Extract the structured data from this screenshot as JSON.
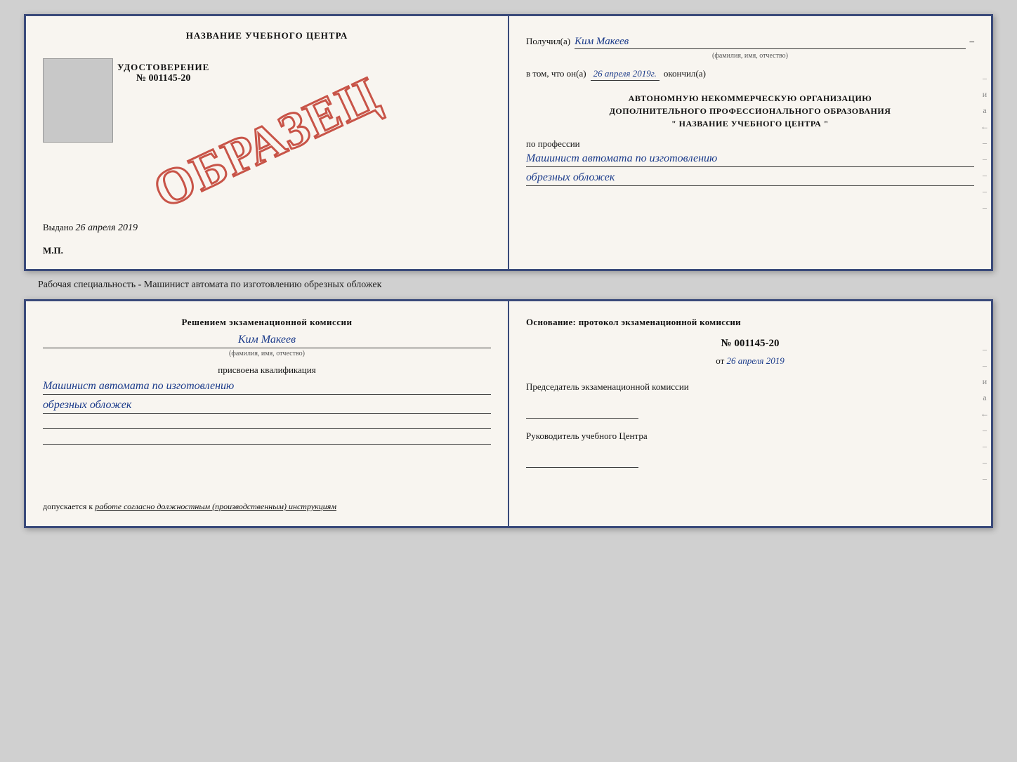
{
  "top_doc": {
    "left": {
      "title": "НАЗВАНИЕ УЧЕБНОГО ЦЕНТРА",
      "obrazec": "ОБРАЗЕЦ",
      "udost_label": "УДОСТОВЕРЕНИЕ",
      "udost_num": "№ 001145-20",
      "vydano_prefix": "Выдано",
      "vydano_date": "26 апреля 2019",
      "mp": "М.П."
    },
    "right": {
      "poluchil_prefix": "Получил(а)",
      "poluchil_name": "Ким Макеев",
      "fio_label": "(фамилия, имя, отчество)",
      "vtom_prefix": "в том, что он(а)",
      "vtom_date": "26 апреля 2019г.",
      "okончil": "окончил(а)",
      "org_line1": "АВТОНОМНУЮ НЕКОММЕРЧЕСКУЮ ОРГАНИЗАЦИЮ",
      "org_line2": "ДОПОЛНИТЕЛЬНОГО ПРОФЕССИОНАЛЬНОГО ОБРАЗОВАНИЯ",
      "org_line3": "\"  НАЗВАНИЕ УЧЕБНОГО ЦЕНТРА  \"",
      "po_professii": "по профессии",
      "profession1": "Машинист автомата по изготовлению",
      "profession2": "обрезных обложек"
    }
  },
  "caption": "Рабочая специальность - Машинист автомата по изготовлению обрезных обложек",
  "bottom_doc": {
    "left": {
      "resheniem": "Решением экзаменационной комиссии",
      "name": "Ким Макеев",
      "fio_label": "(фамилия, имя, отчество)",
      "prisvoena": "присвоена квалификация",
      "profession1": "Машинист автомата по изготовлению",
      "profession2": "обрезных обложек",
      "dopusk_prefix": "допускается к",
      "dopusk_val": "работе согласно должностным (производственным) инструкциям"
    },
    "right": {
      "osnovanie": "Основание: протокол экзаменационной комиссии",
      "protocol_num": "№  001145-20",
      "ot_prefix": "от",
      "ot_date": "26 апреля 2019",
      "predsedatel_label": "Председатель экзаменационной комиссии",
      "rukovoditel_label": "Руководитель учебного Центра"
    }
  },
  "side_marks": {
    "и": "и",
    "а": "а",
    "strelka": "←",
    "dashes": [
      "–",
      "–",
      "–",
      "–",
      "–",
      "–"
    ]
  }
}
